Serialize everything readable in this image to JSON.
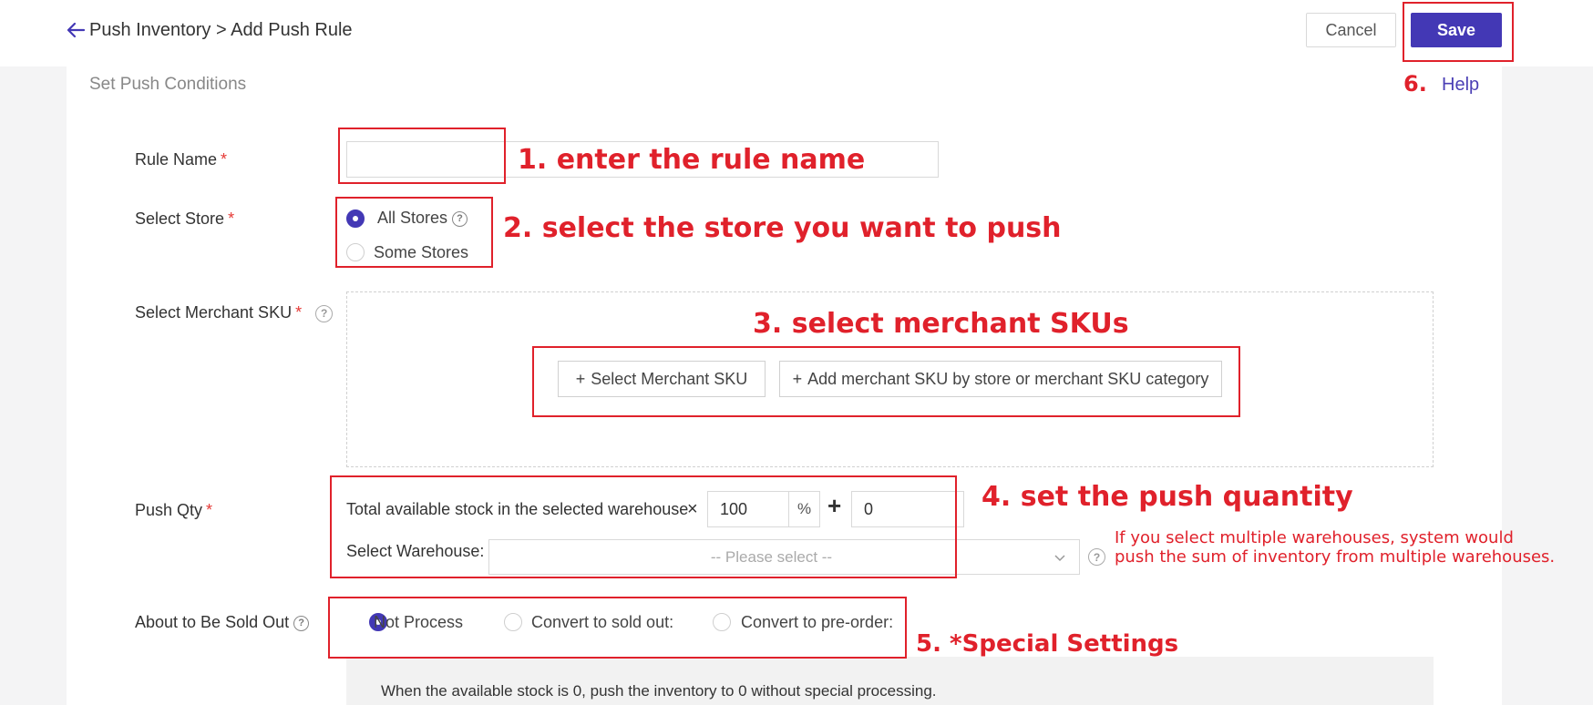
{
  "header": {
    "title": "Push Inventory > Add Push Rule",
    "cancel_label": "Cancel",
    "save_label": "Save"
  },
  "section": {
    "title": "Set Push Conditions",
    "help_label": "Help"
  },
  "form": {
    "rule_name": {
      "label": "Rule Name",
      "required": "*",
      "value": ""
    },
    "select_store": {
      "label": "Select Store",
      "required": "*",
      "options": [
        {
          "label": "All Stores",
          "selected": true
        },
        {
          "label": "Some Stores",
          "selected": false
        }
      ]
    },
    "merchant_sku": {
      "label": "Select Merchant SKU",
      "required": "*",
      "select_button": "Select Merchant SKU",
      "add_button": "Add merchant SKU by store or merchant SKU category"
    },
    "push_qty": {
      "label": "Push Qty",
      "required": "*",
      "stock_text": "Total available stock in the selected warehouse",
      "multiply": "×",
      "percent_value": "100",
      "percent_unit": "%",
      "plus": "+",
      "add_value": "0",
      "warehouse_label": "Select Warehouse:",
      "warehouse_placeholder": "-- Please select --"
    },
    "sold_out": {
      "label": "About to Be Sold Out",
      "options": [
        {
          "label": "Not Process",
          "selected": true
        },
        {
          "label": "Convert to sold out:",
          "selected": false
        },
        {
          "label": "Convert to pre-order:",
          "selected": false
        }
      ],
      "info_text": "When the available stock is 0, push the inventory to 0 without special processing."
    }
  },
  "annotations": {
    "step1": "1. enter the rule name",
    "step2": "2. select the store you want to push",
    "step3": "3. select merchant SKUs",
    "step4": "4. set the push quantity",
    "step4_note_line1": "If you select multiple warehouses, system would",
    "step4_note_line2": "push the sum of inventory from multiple warehouses.",
    "step5": "5. *Special Settings",
    "step6": "6."
  },
  "colors": {
    "primary": "#4338b5",
    "annotation_red": "#e0212b",
    "required_red": "#e53935"
  }
}
